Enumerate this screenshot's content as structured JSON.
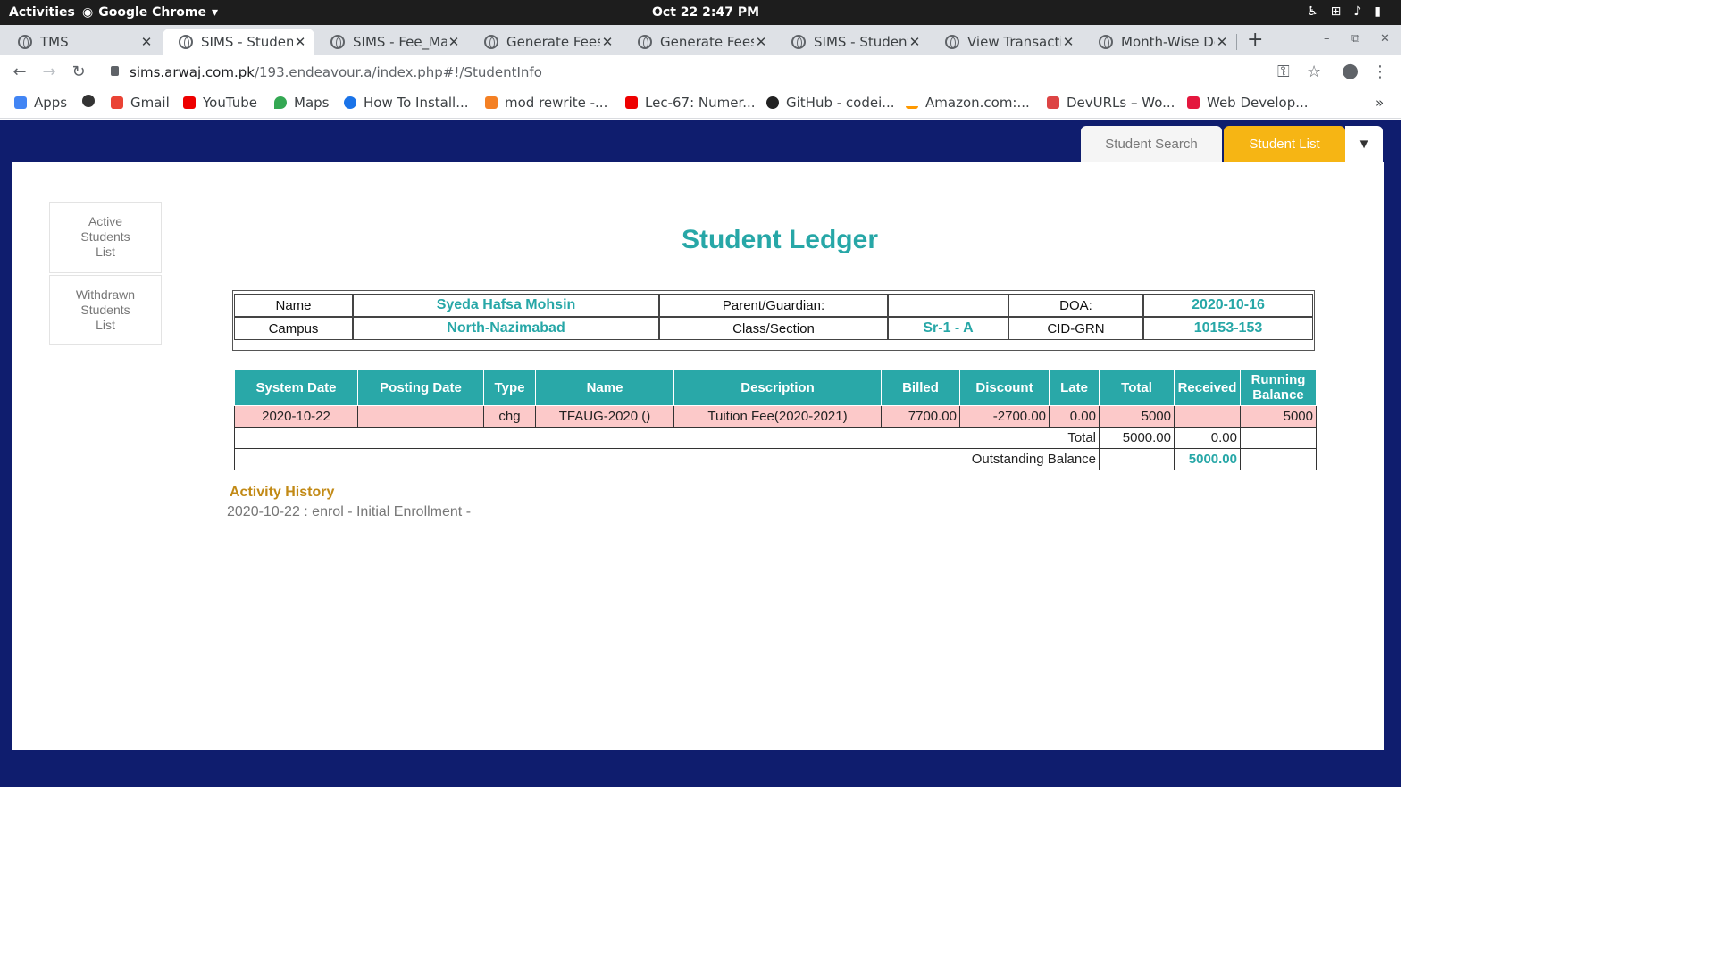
{
  "os": {
    "activities": "Activities",
    "app": "Google Chrome",
    "clock": "Oct 22  2:47 PM"
  },
  "tabs": [
    {
      "label": "TMS"
    },
    {
      "label": "SIMS - StudentInfo"
    },
    {
      "label": "SIMS - Fee_Management"
    },
    {
      "label": "Generate Fees"
    },
    {
      "label": "Generate Fees"
    },
    {
      "label": "SIMS - StudentInfo"
    },
    {
      "label": "View Transaction"
    },
    {
      "label": "Month-Wise Details"
    }
  ],
  "address": {
    "host": "sims.arwaj.com.pk",
    "path": "/193.endeavour.a/index.php#!/StudentInfo"
  },
  "bookmarks": [
    "Apps",
    "",
    "Gmail",
    "YouTube",
    "Maps",
    "How To Install...",
    "mod rewrite -...",
    "Lec-67: Numer...",
    "GitHub - codei...",
    "Amazon.com:...",
    "DevURLs – Wo...",
    "Web Develop..."
  ],
  "nav": {
    "search": "Student Search",
    "list": "Student List"
  },
  "sidebar": {
    "active": [
      "Active",
      "Students",
      "List"
    ],
    "withdrawn": [
      "Withdrawn",
      "Students",
      "List"
    ]
  },
  "title": "Student Ledger",
  "info": {
    "name_label": "Name",
    "name": "Syeda Hafsa Mohsin",
    "parent_label": "Parent/Guardian:",
    "parent": "",
    "doa_label": "DOA:",
    "doa": "2020-10-16",
    "campus_label": "Campus",
    "campus": "North-Nazimabad",
    "class_label": "Class/Section",
    "class": "Sr-1 - A",
    "cid_label": "CID-GRN",
    "cid": "10153-153"
  },
  "ledger": {
    "headers": [
      "System Date",
      "Posting Date",
      "Type",
      "Name",
      "Description",
      "Billed",
      "Discount",
      "Late",
      "Total",
      "Received",
      "Running Balance"
    ],
    "rows": [
      [
        "2020-10-22",
        "",
        "chg",
        "TFAUG-2020 ()",
        "Tuition Fee(2020-2021)",
        "7700.00",
        "-2700.00",
        "0.00",
        "5000",
        "",
        "5000"
      ]
    ],
    "total_label": "Total",
    "total": "5000.00",
    "received_total": "0.00",
    "outstanding_label": "Outstanding Balance",
    "outstanding": "5000.00"
  },
  "activity": {
    "title": "Activity History",
    "entries": [
      "2020-10-22 : enrol - Initial Enrollment -"
    ]
  }
}
